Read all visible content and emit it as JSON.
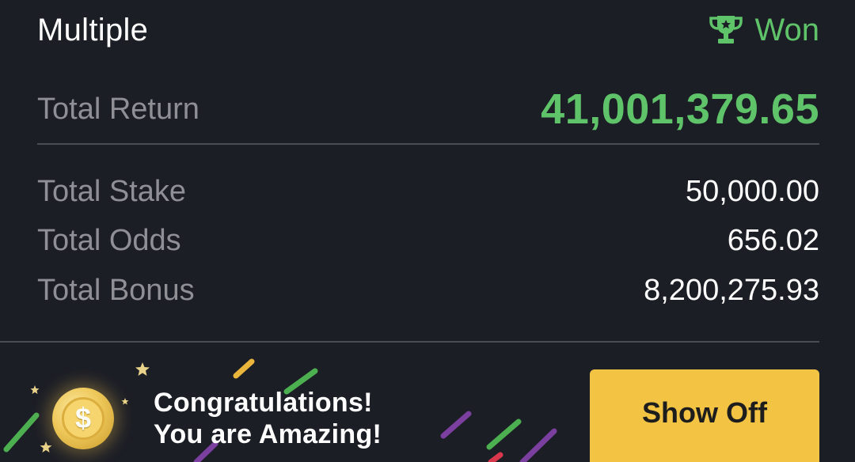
{
  "header": {
    "bet_type": "Multiple",
    "status": "Won",
    "status_icon": "trophy-icon",
    "status_color": "#5fc36a"
  },
  "summary": {
    "return_label": "Total Return",
    "return_value": "41,001,379.65",
    "rows": [
      {
        "label": "Total Stake",
        "value": "50,000.00"
      },
      {
        "label": "Total Odds",
        "value": "656.02"
      },
      {
        "label": "Total Bonus",
        "value": "8,200,275.93"
      }
    ]
  },
  "banner": {
    "coin_icon": "dollar-coin-icon",
    "coin_symbol": "$",
    "line1": "Congratulations!",
    "line2": "You are Amazing!",
    "button_label": "Show Off",
    "button_color": "#f3c443"
  },
  "colors": {
    "background": "#1c1e26",
    "accent_green": "#5fc36a",
    "label_gray": "#8f9096"
  }
}
